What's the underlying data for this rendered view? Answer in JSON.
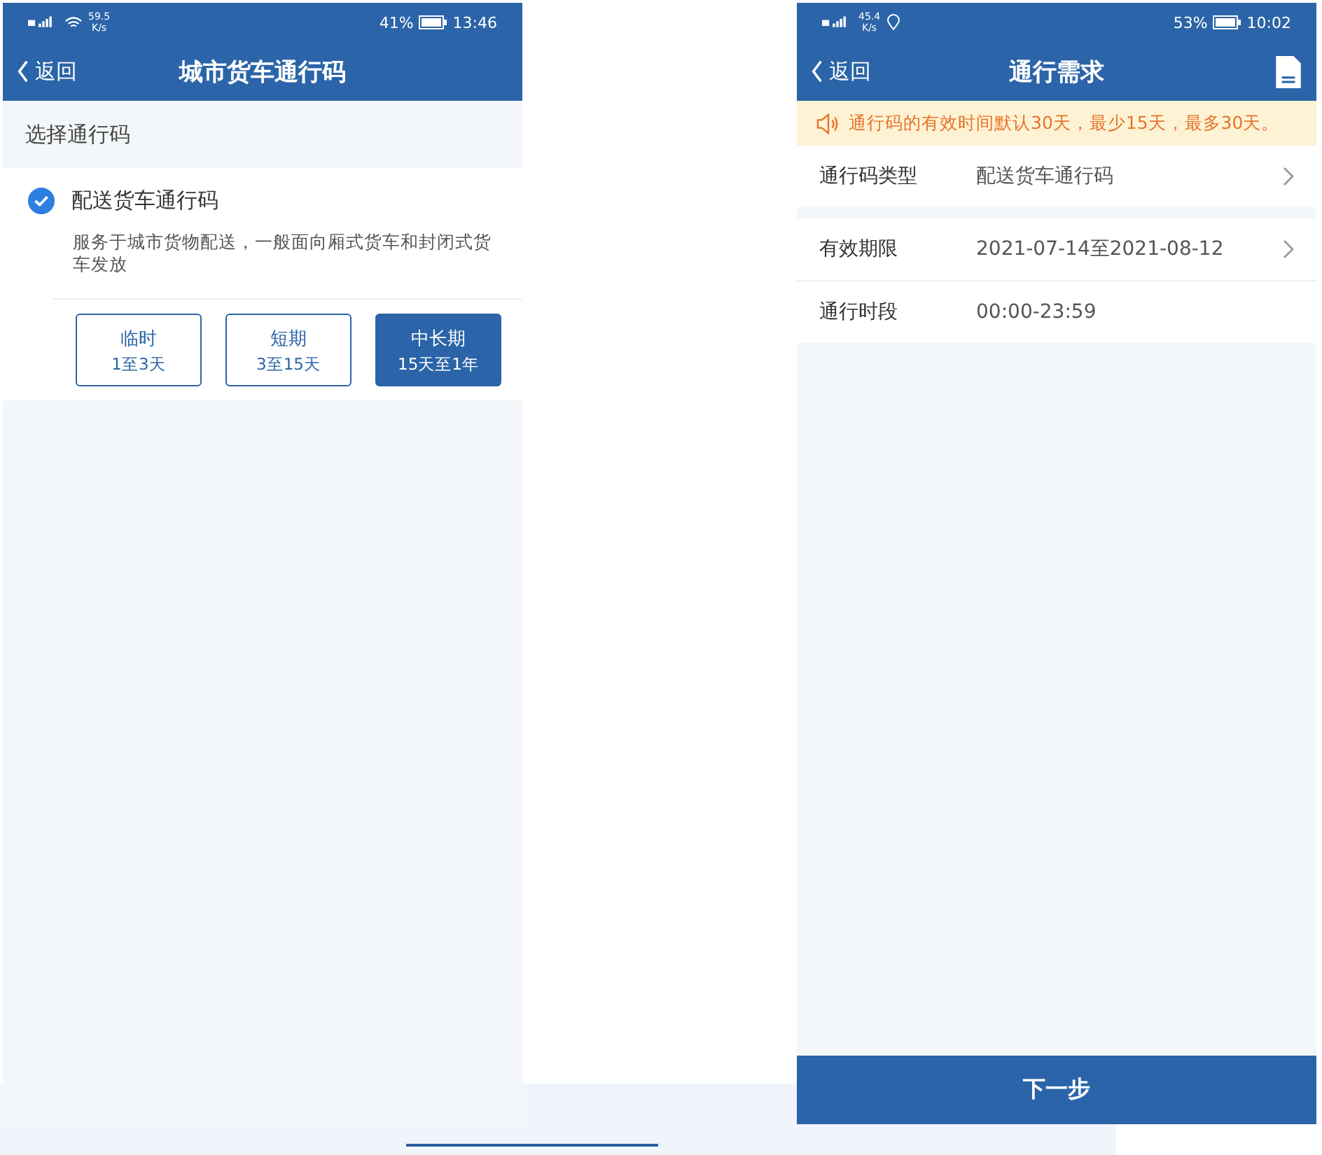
{
  "pass_code_screen": {
    "status_bar": {
      "network_speed": "59.5",
      "speed_unit": "K/s",
      "wifi": true,
      "location": false,
      "battery_percent": "41%",
      "time": "13:46"
    },
    "header": {
      "back": "返回",
      "title": "城市货车通行码",
      "rules_button": false
    },
    "section_title": "选择通行码",
    "option": {
      "label": "配送货车通行码",
      "checked": true,
      "description": "服务于城市货物配送，一般面向厢式货车和封闭式货车发放"
    },
    "durations": [
      {
        "name": "临时",
        "range": "1至3天",
        "selected": false
      },
      {
        "name": "短期",
        "range": "3至15天",
        "selected": false
      },
      {
        "name": "中长期",
        "range": "15天至1年",
        "selected": true
      }
    ]
  },
  "requirements_screen": {
    "status_bar": {
      "network_speed": "45.4",
      "speed_unit": "K/s",
      "wifi": false,
      "location": true,
      "battery_percent": "53%",
      "time": "10:02"
    },
    "header": {
      "back": "返回",
      "title": "通行需求",
      "rules_button": true
    },
    "notice": "通行码的有效时间默认30天，最少15天，最多30天。",
    "field_groups": [
      [
        {
          "label": "通行码类型",
          "value": "配送货车通行码",
          "navigable": true
        }
      ],
      [
        {
          "label": "有效期限",
          "value": "2021-07-14至2021-08-12",
          "navigable": true
        },
        {
          "label": "通行时段",
          "value": "00:00-23:59",
          "navigable": false
        }
      ]
    ],
    "next_button": "下一步"
  }
}
